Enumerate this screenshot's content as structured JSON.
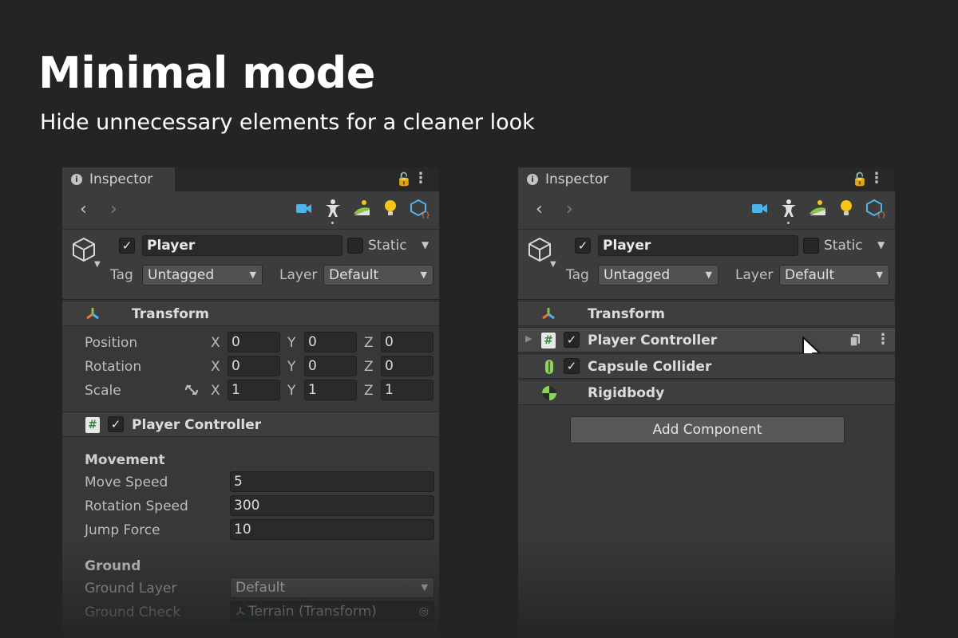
{
  "headline": "Minimal mode",
  "subline": "Hide unnecessary elements for a cleaner look",
  "inspector": {
    "tab_label": "Inspector",
    "object_name": "Player",
    "static_label": "Static",
    "tag_label": "Tag",
    "tag_value": "Untagged",
    "layer_label": "Layer",
    "layer_value": "Default"
  },
  "left_panel": {
    "transform": {
      "title": "Transform",
      "rows": [
        {
          "label": "Position",
          "x": "0",
          "y": "0",
          "z": "0"
        },
        {
          "label": "Rotation",
          "x": "0",
          "y": "0",
          "z": "0"
        },
        {
          "label": "Scale",
          "x": "1",
          "y": "1",
          "z": "1"
        }
      ],
      "axis_labels": [
        "X",
        "Y",
        "Z"
      ]
    },
    "player_controller": {
      "title": "Player Controller",
      "movement_header": "Movement",
      "fields": [
        {
          "label": "Move Speed",
          "value": "5"
        },
        {
          "label": "Rotation Speed",
          "value": "300"
        },
        {
          "label": "Jump Force",
          "value": "10"
        }
      ],
      "ground_header": "Ground",
      "ground_layer_label": "Ground Layer",
      "ground_layer_value": "Default",
      "ground_check_label": "Ground Check",
      "ground_check_value": "Terrain (Transform)"
    }
  },
  "right_panel": {
    "components": [
      {
        "title": "Transform"
      },
      {
        "title": "Player Controller"
      },
      {
        "title": "Capsule Collider"
      },
      {
        "title": "Rigidbody"
      }
    ],
    "add_component_label": "Add Component"
  },
  "colors": {
    "background": "#232425",
    "panel": "#383838",
    "camera_icon": "#4fb3e8",
    "terrain_icon": "#8bc34a",
    "light_icon": "#f5c518",
    "prefab_icon": "#4fb3e8",
    "collider_icon": "#8bd35a"
  }
}
